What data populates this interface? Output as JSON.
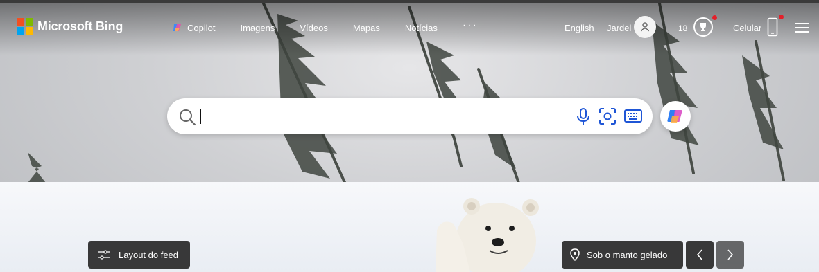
{
  "header": {
    "logo_text": "Microsoft Bing",
    "nav": [
      "Copilot",
      "Imagens",
      "Vídeos",
      "Mapas",
      "Notícias"
    ],
    "more": "···",
    "language": "English",
    "user_name": "Jardel",
    "rewards_points": "18",
    "phone_label": "Celular"
  },
  "search": {
    "placeholder": "",
    "value": ""
  },
  "bottom": {
    "feed_layout": "Layout do feed",
    "image_caption": "Sob o manto gelado"
  },
  "colors": {
    "ms_red": "#f25022",
    "ms_green": "#7fba00",
    "ms_blue": "#00a4ef",
    "ms_yellow": "#ffb900",
    "icon_blue": "#1f56d6",
    "notification": "#e3202a"
  }
}
